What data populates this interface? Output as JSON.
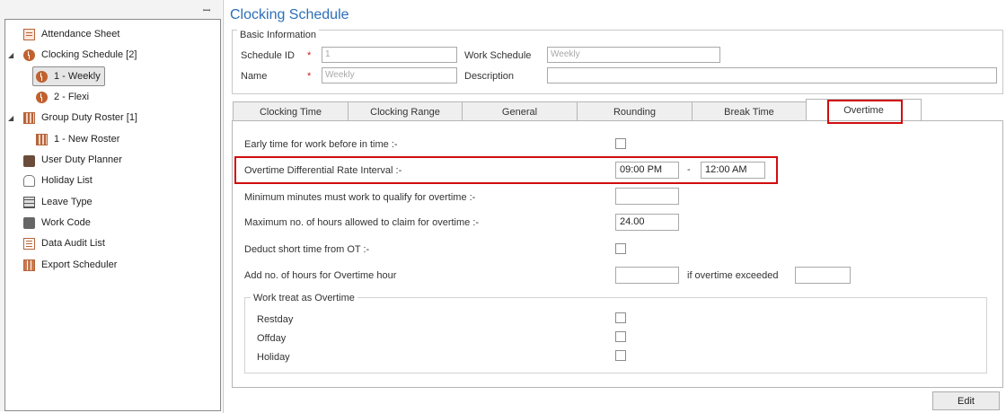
{
  "tree": {
    "pin_icon": "pin-icon",
    "items": [
      {
        "label": "Attendance Sheet",
        "icon": "attendance-sheet-icon"
      },
      {
        "label": "Clocking Schedule [2]",
        "icon": "clock-icon"
      },
      {
        "label": "1 - Weekly",
        "icon": "clock-icon"
      },
      {
        "label": "2 - Flexi",
        "icon": "clock-icon"
      },
      {
        "label": "Group Duty Roster [1]",
        "icon": "roster-icon"
      },
      {
        "label": "1 - New Roster",
        "icon": "roster-icon"
      },
      {
        "label": "User Duty Planner",
        "icon": "briefcase-icon"
      },
      {
        "label": "Holiday List",
        "icon": "slippers-icon"
      },
      {
        "label": "Leave Type",
        "icon": "grid-icon"
      },
      {
        "label": "Work Code",
        "icon": "chat-icon"
      },
      {
        "label": "Data Audit List",
        "icon": "list-icon"
      },
      {
        "label": "Export Scheduler",
        "icon": "export-icon"
      }
    ],
    "expander_symbol": "◢"
  },
  "page": {
    "title": "Clocking Schedule"
  },
  "basic_info": {
    "legend": "Basic Information",
    "schedule_id_label": "Schedule ID",
    "schedule_id_value": "1",
    "name_label": "Name",
    "name_value": "Weekly",
    "work_schedule_label": "Work Schedule",
    "work_schedule_value": "Weekly",
    "description_label": "Description",
    "description_value": "",
    "required_mark": "*"
  },
  "tabs": [
    "Clocking Time",
    "Clocking Range",
    "General",
    "Rounding",
    "Break Time",
    "Overtime"
  ],
  "active_tab": "Overtime",
  "overtime": {
    "early_time_label": "Early time for work before in time :-",
    "differential_label": "Overtime Differential Rate Interval :-",
    "differential_from": "09:00 PM",
    "differential_sep": "-",
    "differential_to": "12:00 AM",
    "min_minutes_label": "Minimum minutes must work to qualify for overtime :-",
    "min_minutes_value": "",
    "max_hours_label": "Maximum no. of hours allowed to claim for overtime :-",
    "max_hours_value": "24.00",
    "deduct_short_label": "Deduct short time from OT :-",
    "add_hours_label": "Add no. of hours for Overtime hour",
    "add_hours_value": "",
    "if_exceeded_label": "if overtime exceeded",
    "if_exceeded_value": "",
    "work_treat_legend": "Work treat as Overtime",
    "restday_label": "Restday",
    "offday_label": "Offday",
    "holiday_label": "Holiday"
  },
  "buttons": {
    "edit": "Edit"
  },
  "colors": {
    "accent": "#2c6fb8",
    "highlight": "#d10d0d"
  }
}
